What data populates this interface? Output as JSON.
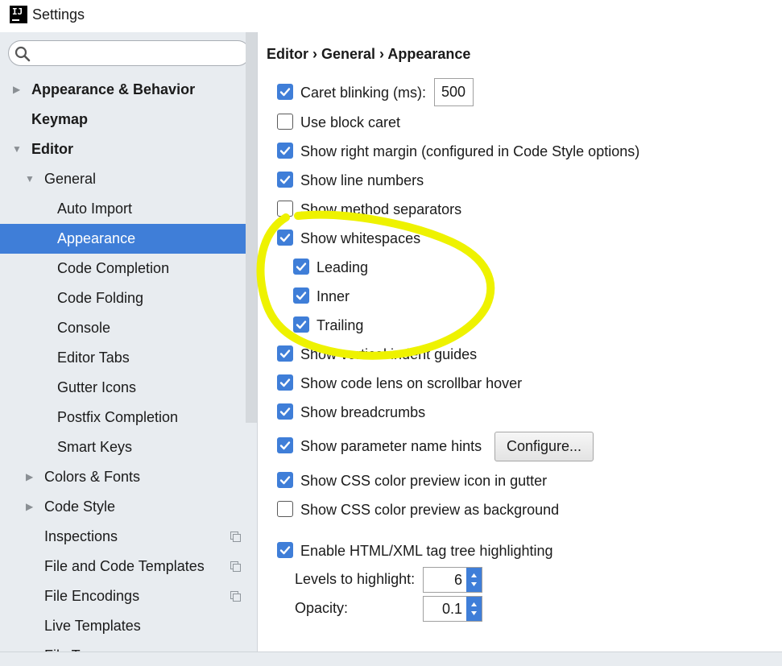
{
  "window": {
    "title": "Settings",
    "logo_text": "IJ"
  },
  "search": {
    "value": "",
    "placeholder": ""
  },
  "sidebar": {
    "items": [
      {
        "label": "Appearance & Behavior"
      },
      {
        "label": "Keymap"
      },
      {
        "label": "Editor"
      },
      {
        "label": "General"
      },
      {
        "label": "Auto Import"
      },
      {
        "label": "Appearance"
      },
      {
        "label": "Code Completion"
      },
      {
        "label": "Code Folding"
      },
      {
        "label": "Console"
      },
      {
        "label": "Editor Tabs"
      },
      {
        "label": "Gutter Icons"
      },
      {
        "label": "Postfix Completion"
      },
      {
        "label": "Smart Keys"
      },
      {
        "label": "Colors & Fonts"
      },
      {
        "label": "Code Style"
      },
      {
        "label": "Inspections"
      },
      {
        "label": "File and Code Templates"
      },
      {
        "label": "File Encodings"
      },
      {
        "label": "Live Templates"
      },
      {
        "label": "File Ty"
      }
    ]
  },
  "breadcrumb": "Editor › General › Appearance",
  "options": [
    {
      "label": "Caret blinking (ms):",
      "checked": true
    },
    {
      "label": "Use block caret",
      "checked": false
    },
    {
      "label": "Show right margin (configured in Code Style options)",
      "checked": true
    },
    {
      "label": "Show line numbers",
      "checked": true
    },
    {
      "label": "Show method separators",
      "checked": false
    },
    {
      "label": "Show whitespaces",
      "checked": true
    },
    {
      "label": "Leading",
      "checked": true
    },
    {
      "label": "Inner",
      "checked": true
    },
    {
      "label": "Trailing",
      "checked": true
    },
    {
      "label": "Show vertical indent guides",
      "checked": true
    },
    {
      "label": "Show code lens on scrollbar hover",
      "checked": true
    },
    {
      "label": "Show breadcrumbs",
      "checked": true
    },
    {
      "label": "Show parameter name hints",
      "checked": true
    },
    {
      "label": "Show CSS color preview icon in gutter",
      "checked": true
    },
    {
      "label": "Show CSS color preview as background",
      "checked": false
    },
    {
      "label": "Enable HTML/XML tag tree highlighting",
      "checked": true
    }
  ],
  "caret_blink_value": "500",
  "configure_button": "Configure...",
  "levels": {
    "label": "Levels to highlight:",
    "value": "6"
  },
  "opacity": {
    "label": "Opacity:",
    "value": "0.1"
  },
  "colors": {
    "accent": "#3f7ed8",
    "sidebar_bg": "#e8ecf0",
    "annotation": "#eef200"
  }
}
